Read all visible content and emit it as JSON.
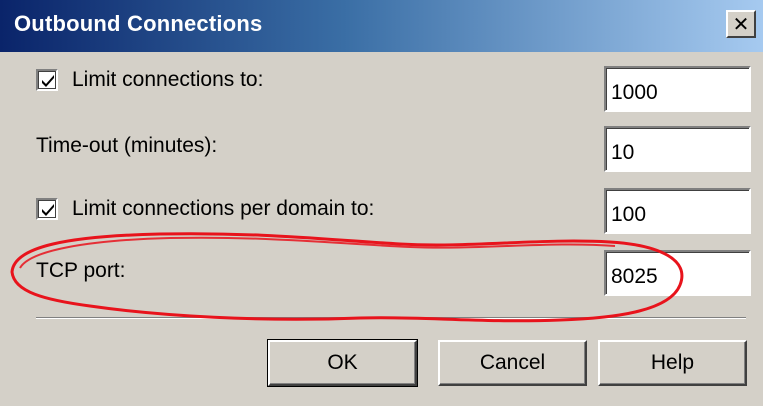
{
  "window": {
    "title": "Outbound Connections"
  },
  "icons": {
    "close": "close-icon",
    "check": "checkmark-icon"
  },
  "settings": {
    "limit_connections": {
      "label": "Limit connections to:",
      "checked": true,
      "value": "1000"
    },
    "timeout": {
      "label": "Time-out (minutes):",
      "value": "10"
    },
    "limit_per_domain": {
      "label": "Limit connections per domain to:",
      "checked": true,
      "value": "100"
    },
    "tcp_port": {
      "label": "TCP port:",
      "value": "8025"
    }
  },
  "buttons": {
    "ok": "OK",
    "cancel": "Cancel",
    "help": "Help"
  },
  "colors": {
    "annotation": "#e8131c",
    "titlebar_start": "#0a246a",
    "titlebar_end": "#a6caf0"
  }
}
